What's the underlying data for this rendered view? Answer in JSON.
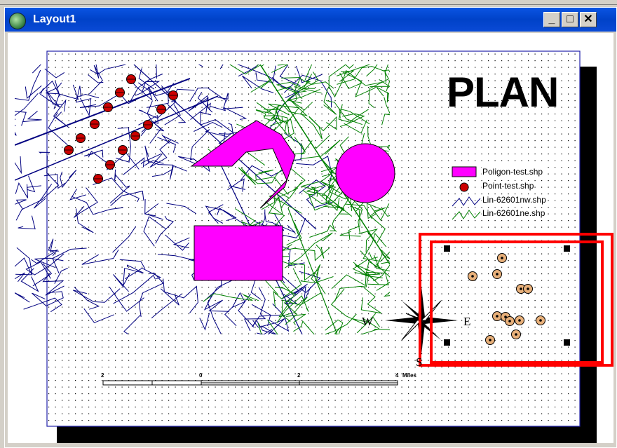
{
  "window": {
    "title": "Layout1",
    "minimize": "_",
    "maximize": "□",
    "close": "✕"
  },
  "map": {
    "title": "PLAN",
    "legend": [
      {
        "label": "Poligon-test.shp",
        "symbol": "polygon",
        "color": "#ff00ff"
      },
      {
        "label": "Point-test.shp",
        "symbol": "point",
        "color": "#cc0000"
      },
      {
        "label": "Lin-62601nw.shp",
        "symbol": "line",
        "color": "#000080"
      },
      {
        "label": "Lin-62601ne.shp",
        "symbol": "line",
        "color": "#008000"
      }
    ],
    "compass": {
      "west": "W",
      "east": "E",
      "south": "S"
    },
    "scalebar": {
      "ticks": [
        "2",
        "0",
        "2",
        "4"
      ],
      "units": "Miles"
    }
  },
  "colors": {
    "highlight": "#ff0000",
    "polygon": "#ff00ff",
    "nw_lines": "#000080",
    "ne_lines": "#008000"
  }
}
